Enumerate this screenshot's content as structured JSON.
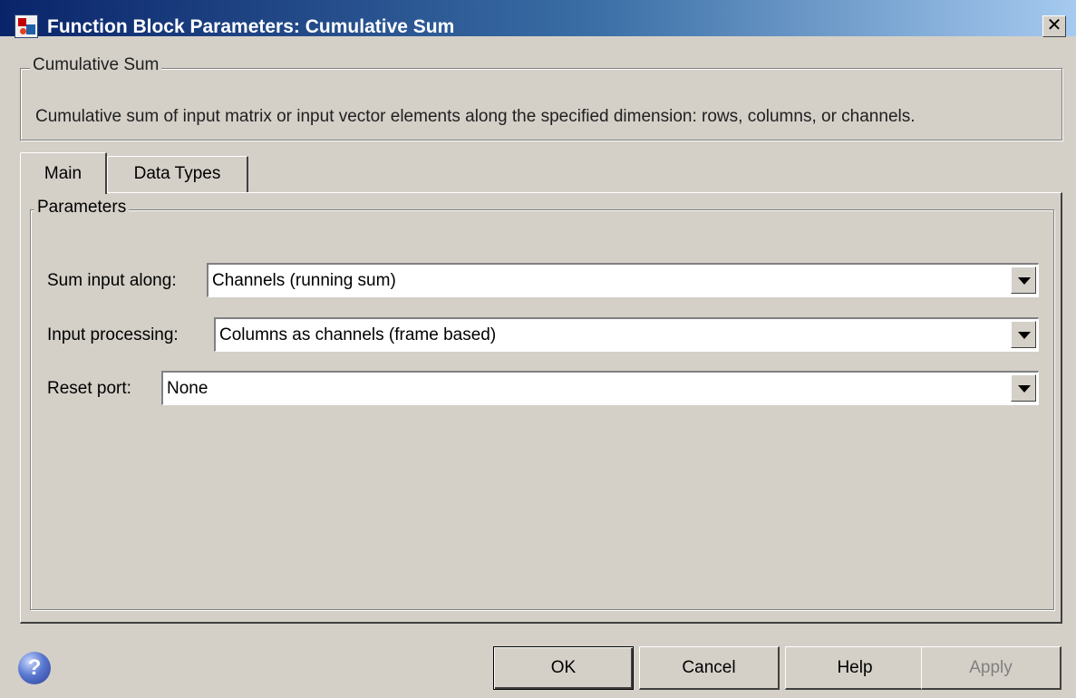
{
  "window": {
    "title": "Function Block Parameters: Cumulative Sum",
    "close_glyph": "✕"
  },
  "description": {
    "legend": "Cumulative Sum",
    "text": "Cumulative sum of input matrix or input vector elements along the specified dimension: rows, columns, or channels."
  },
  "tabs": [
    {
      "label": "Main",
      "selected": true
    },
    {
      "label": "Data Types",
      "selected": false
    }
  ],
  "parameters": {
    "legend": "Parameters",
    "rows": [
      {
        "label": "Sum input along:",
        "value": "Channels (running sum)"
      },
      {
        "label": "Input processing:",
        "value": "Columns as channels (frame based)"
      },
      {
        "label": "Reset port:",
        "value": "None"
      }
    ]
  },
  "footer": {
    "help_icon_glyph": "?",
    "buttons": {
      "ok": "OK",
      "cancel": "Cancel",
      "help": "Help",
      "apply": "Apply"
    },
    "apply_enabled": false
  },
  "icons": {
    "title_icon": "simulink-block-icon",
    "help_icon": "help-question-icon",
    "dropdown": "chevron-down-icon"
  },
  "colors": {
    "dialog_bg": "#d4d0c8",
    "titlebar_start": "#0a246a",
    "titlebar_end": "#a6caf0",
    "disabled_text": "#808080"
  }
}
